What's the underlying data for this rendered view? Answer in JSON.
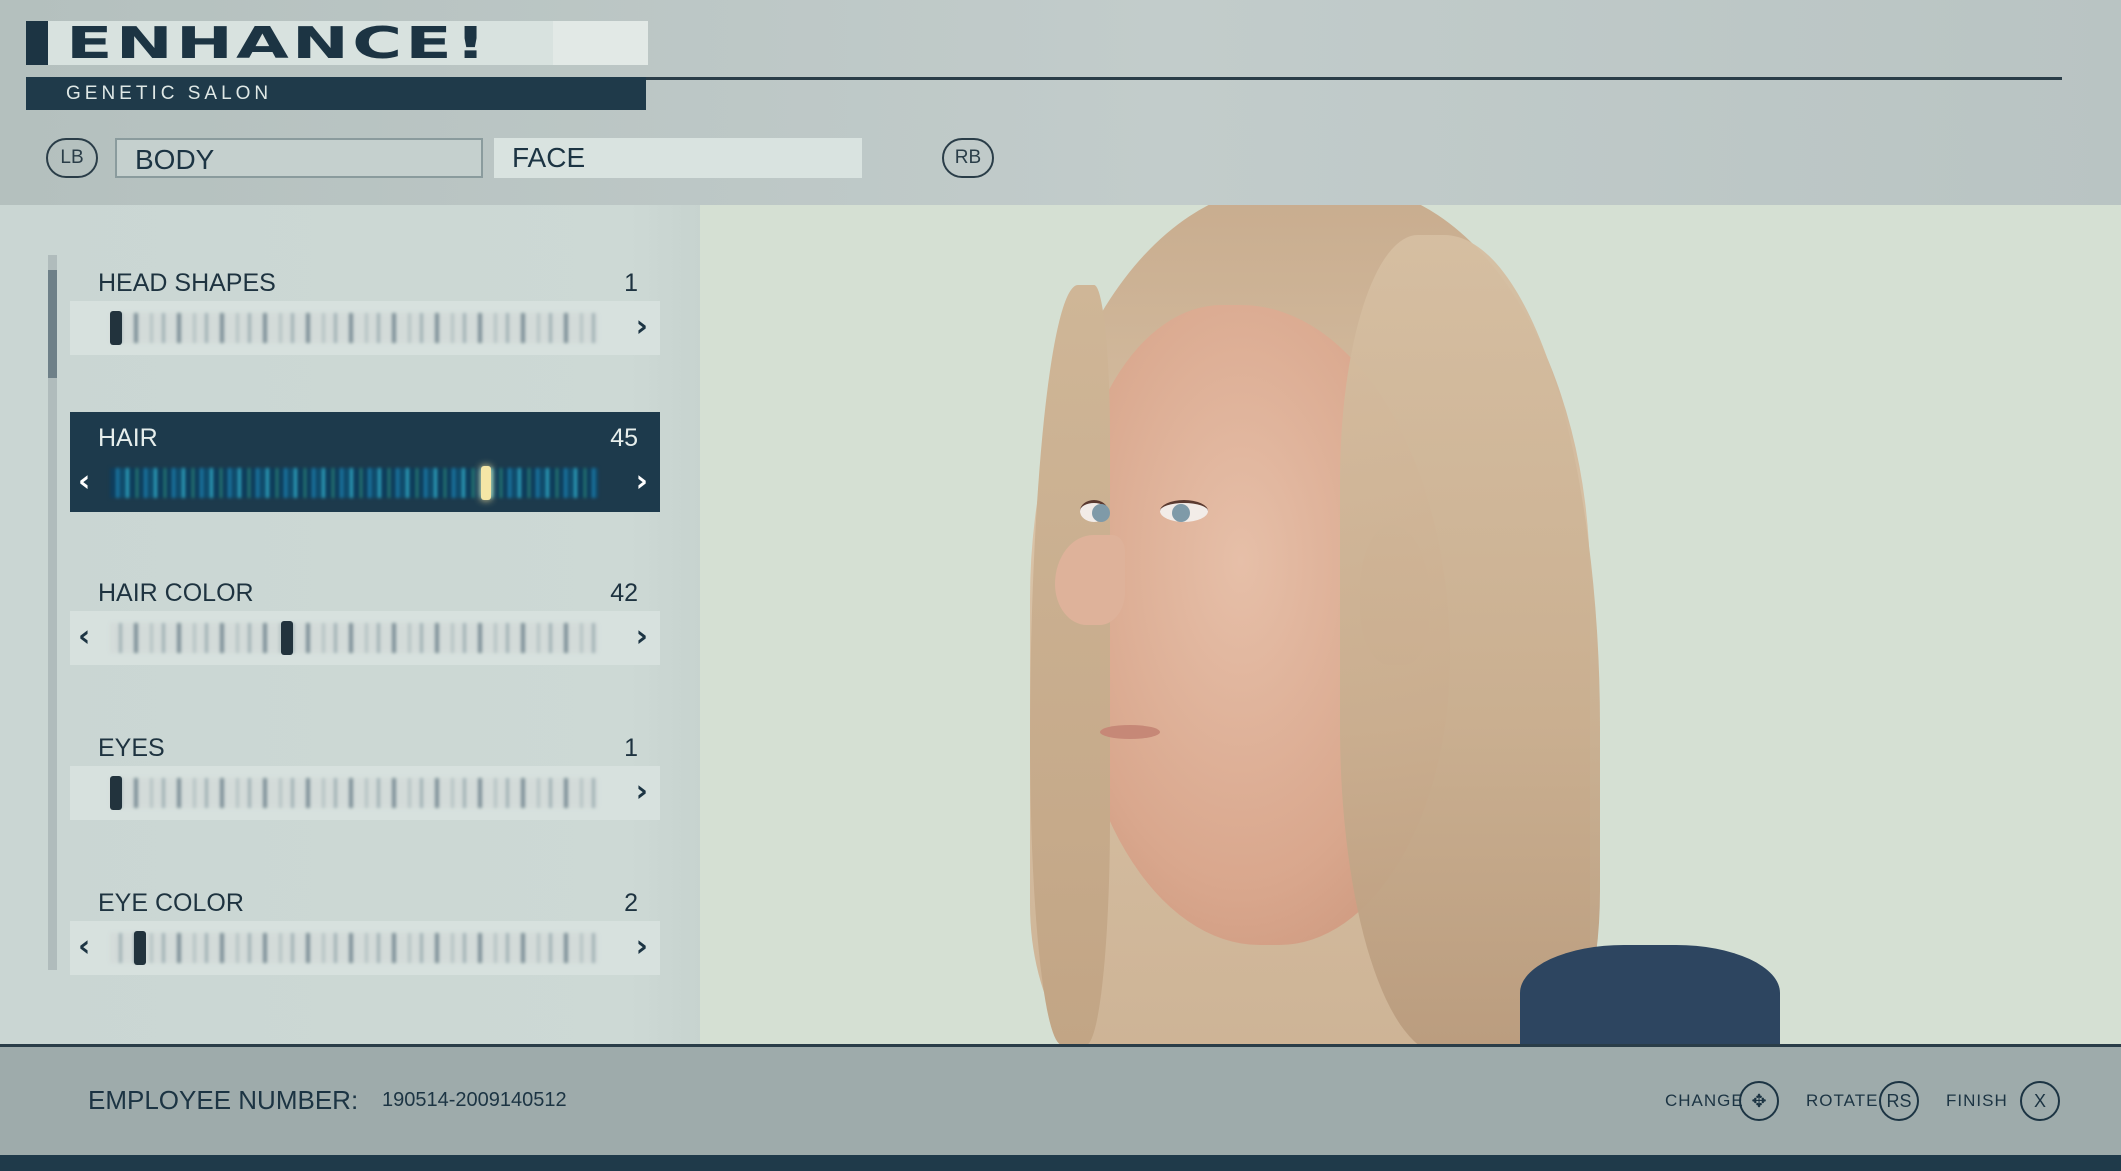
{
  "header": {
    "logo": "ENHANCE!",
    "subtitle": "GENETIC SALON",
    "left_bumper": "LB",
    "right_bumper": "RB",
    "tabs": [
      {
        "label": "BODY"
      },
      {
        "label": "FACE"
      }
    ]
  },
  "panel": {
    "items": [
      {
        "label": "HEAD SHAPES",
        "value": "1",
        "position": 0.0
      },
      {
        "label": "HAIR",
        "value": "45",
        "position": 0.78,
        "selected": true
      },
      {
        "label": "HAIR COLOR",
        "value": "42",
        "position": 0.36
      },
      {
        "label": "EYES",
        "value": "1",
        "position": 0.0
      },
      {
        "label": "EYE COLOR",
        "value": "2",
        "position": 0.05
      }
    ]
  },
  "footer": {
    "employee_label": "EMPLOYEE NUMBER:",
    "employee_number": "190514-2009140512",
    "prompts": [
      {
        "label": "CHANGE",
        "button": "✥"
      },
      {
        "label": "ROTATE",
        "button": "RS"
      },
      {
        "label": "FINISH",
        "button": "X"
      }
    ]
  },
  "colors": {
    "accent_dark": "#1d3a4c",
    "selected_knob": "#f5e6a6"
  }
}
